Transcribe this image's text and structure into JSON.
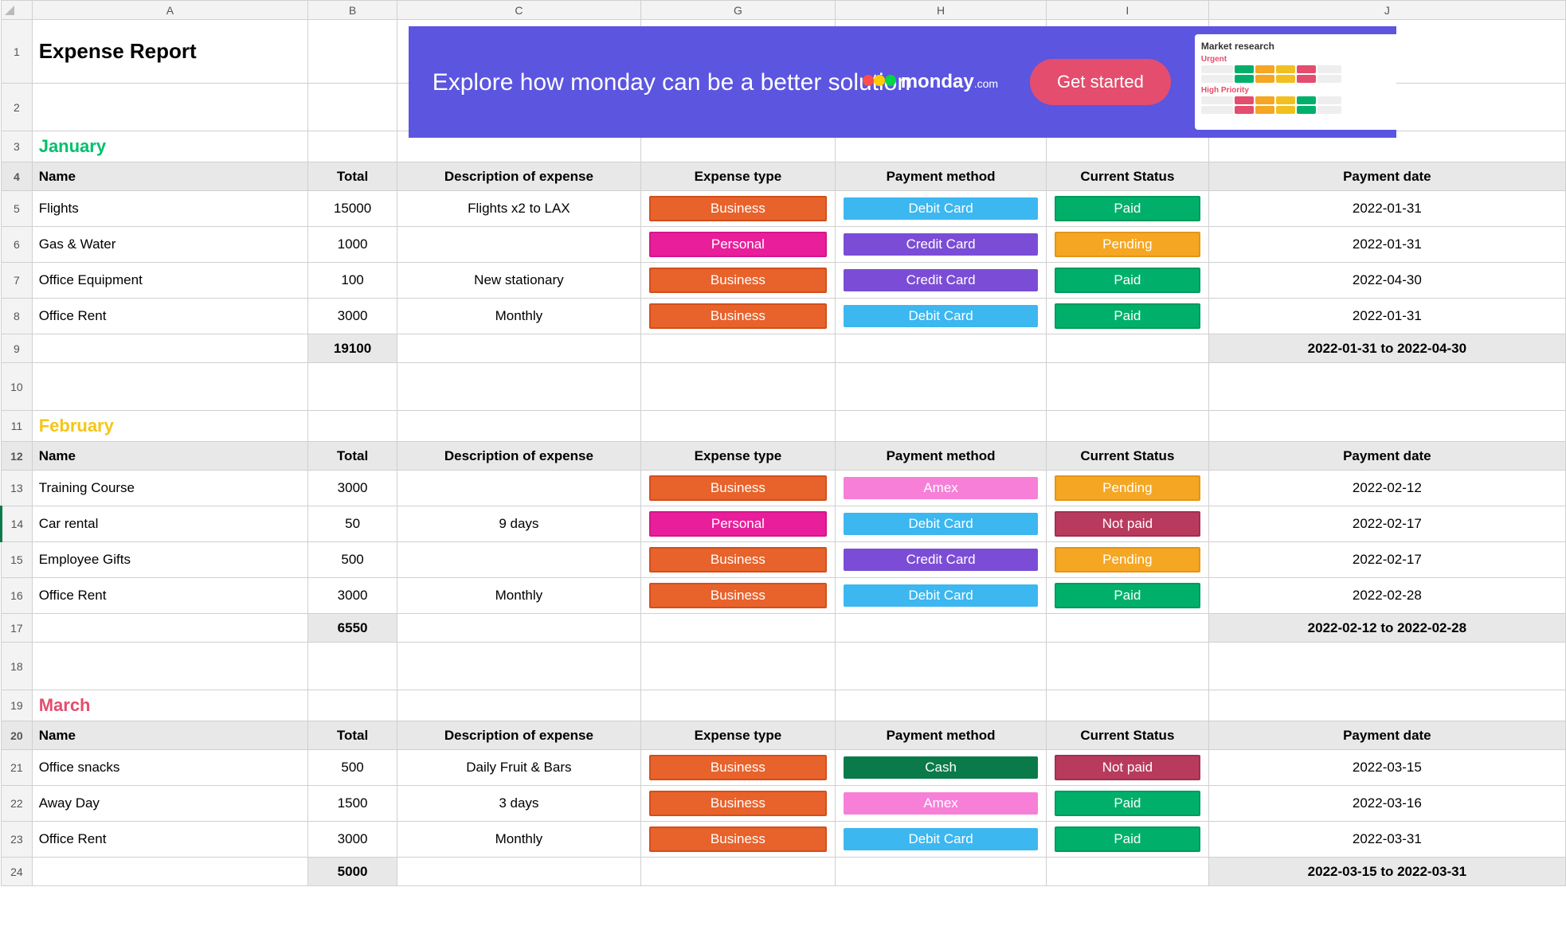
{
  "columnHeaders": [
    "",
    "A",
    "B",
    "C",
    "G",
    "H",
    "I",
    "J"
  ],
  "title": "Expense Report",
  "banner": {
    "headline": "Explore how monday can be a better solution",
    "brand": "monday",
    "brandSuffix": ".com",
    "cta": "Get started",
    "previewTitle": "Market research",
    "previewSub1": "Urgent",
    "previewSub2": "High Priority"
  },
  "months": [
    {
      "rowStart": 3,
      "name": "January",
      "nameClass": "month-jan",
      "headers": {
        "name": "Name",
        "total": "Total",
        "desc": "Description of expense",
        "type": "Expense type",
        "method": "Payment method",
        "status": "Current Status",
        "date": "Payment date"
      },
      "items": [
        {
          "name": "Flights",
          "total": "15000",
          "desc": "Flights x2 to LAX",
          "type": "Business",
          "method": "Debit Card",
          "status": "Paid",
          "date": "2022-01-31"
        },
        {
          "name": "Gas & Water",
          "total": "1000",
          "desc": "",
          "type": "Personal",
          "method": "Credit Card",
          "status": "Pending",
          "date": "2022-01-31"
        },
        {
          "name": "Office Equipment",
          "total": "100",
          "desc": "New stationary",
          "type": "Business",
          "method": "Credit Card",
          "status": "Paid",
          "date": "2022-04-30"
        },
        {
          "name": "Office Rent",
          "total": "3000",
          "desc": "Monthly",
          "type": "Business",
          "method": "Debit Card",
          "status": "Paid",
          "date": "2022-01-31"
        }
      ],
      "sumTotal": "19100",
      "sumRange": "2022-01-31 to 2022-04-30"
    },
    {
      "rowStart": 11,
      "name": "February",
      "nameClass": "month-feb",
      "headers": {
        "name": "Name",
        "total": "Total",
        "desc": "Description of expense",
        "type": "Expense type",
        "method": "Payment method",
        "status": "Current Status",
        "date": "Payment date"
      },
      "items": [
        {
          "name": "Training Course",
          "total": "3000",
          "desc": "",
          "type": "Business",
          "method": "Amex",
          "status": "Pending",
          "date": "2022-02-12"
        },
        {
          "name": "Car rental",
          "total": "50",
          "desc": "9 days",
          "type": "Personal",
          "method": "Debit Card",
          "status": "Not paid",
          "date": "2022-02-17"
        },
        {
          "name": "Employee Gifts",
          "total": "500",
          "desc": "",
          "type": "Business",
          "method": "Credit Card",
          "status": "Pending",
          "date": "2022-02-17"
        },
        {
          "name": "Office Rent",
          "total": "3000",
          "desc": "Monthly",
          "type": "Business",
          "method": "Debit Card",
          "status": "Paid",
          "date": "2022-02-28"
        }
      ],
      "sumTotal": "6550",
      "sumRange": "2022-02-12 to 2022-02-28"
    },
    {
      "rowStart": 19,
      "name": "March",
      "nameClass": "month-mar",
      "headers": {
        "name": "Name",
        "total": "Total",
        "desc": "Description of expense",
        "type": "Expense type",
        "method": "Payment method",
        "status": "Current Status",
        "date": "Payment date"
      },
      "items": [
        {
          "name": "Office snacks",
          "total": "500",
          "desc": "Daily Fruit & Bars",
          "type": "Business",
          "method": "Cash",
          "status": "Not paid",
          "date": "2022-03-15"
        },
        {
          "name": "Away Day",
          "total": "1500",
          "desc": "3 days",
          "type": "Business",
          "method": "Amex",
          "status": "Paid",
          "date": "2022-03-16"
        },
        {
          "name": "Office Rent",
          "total": "3000",
          "desc": "Monthly",
          "type": "Business",
          "method": "Debit Card",
          "status": "Paid",
          "date": "2022-03-31"
        }
      ],
      "sumTotal": "5000",
      "sumRange": "2022-03-15 to 2022-03-31"
    }
  ],
  "tagStyles": {
    "type": {
      "Business": "exp-business",
      "Personal": "exp-personal"
    },
    "method": {
      "Debit Card": "pay-debit",
      "Credit Card": "pay-credit",
      "Amex": "pay-amex",
      "Cash": "pay-cash"
    },
    "status": {
      "Paid": "st-paid",
      "Pending": "st-pending",
      "Not paid": "st-notpaid"
    }
  }
}
